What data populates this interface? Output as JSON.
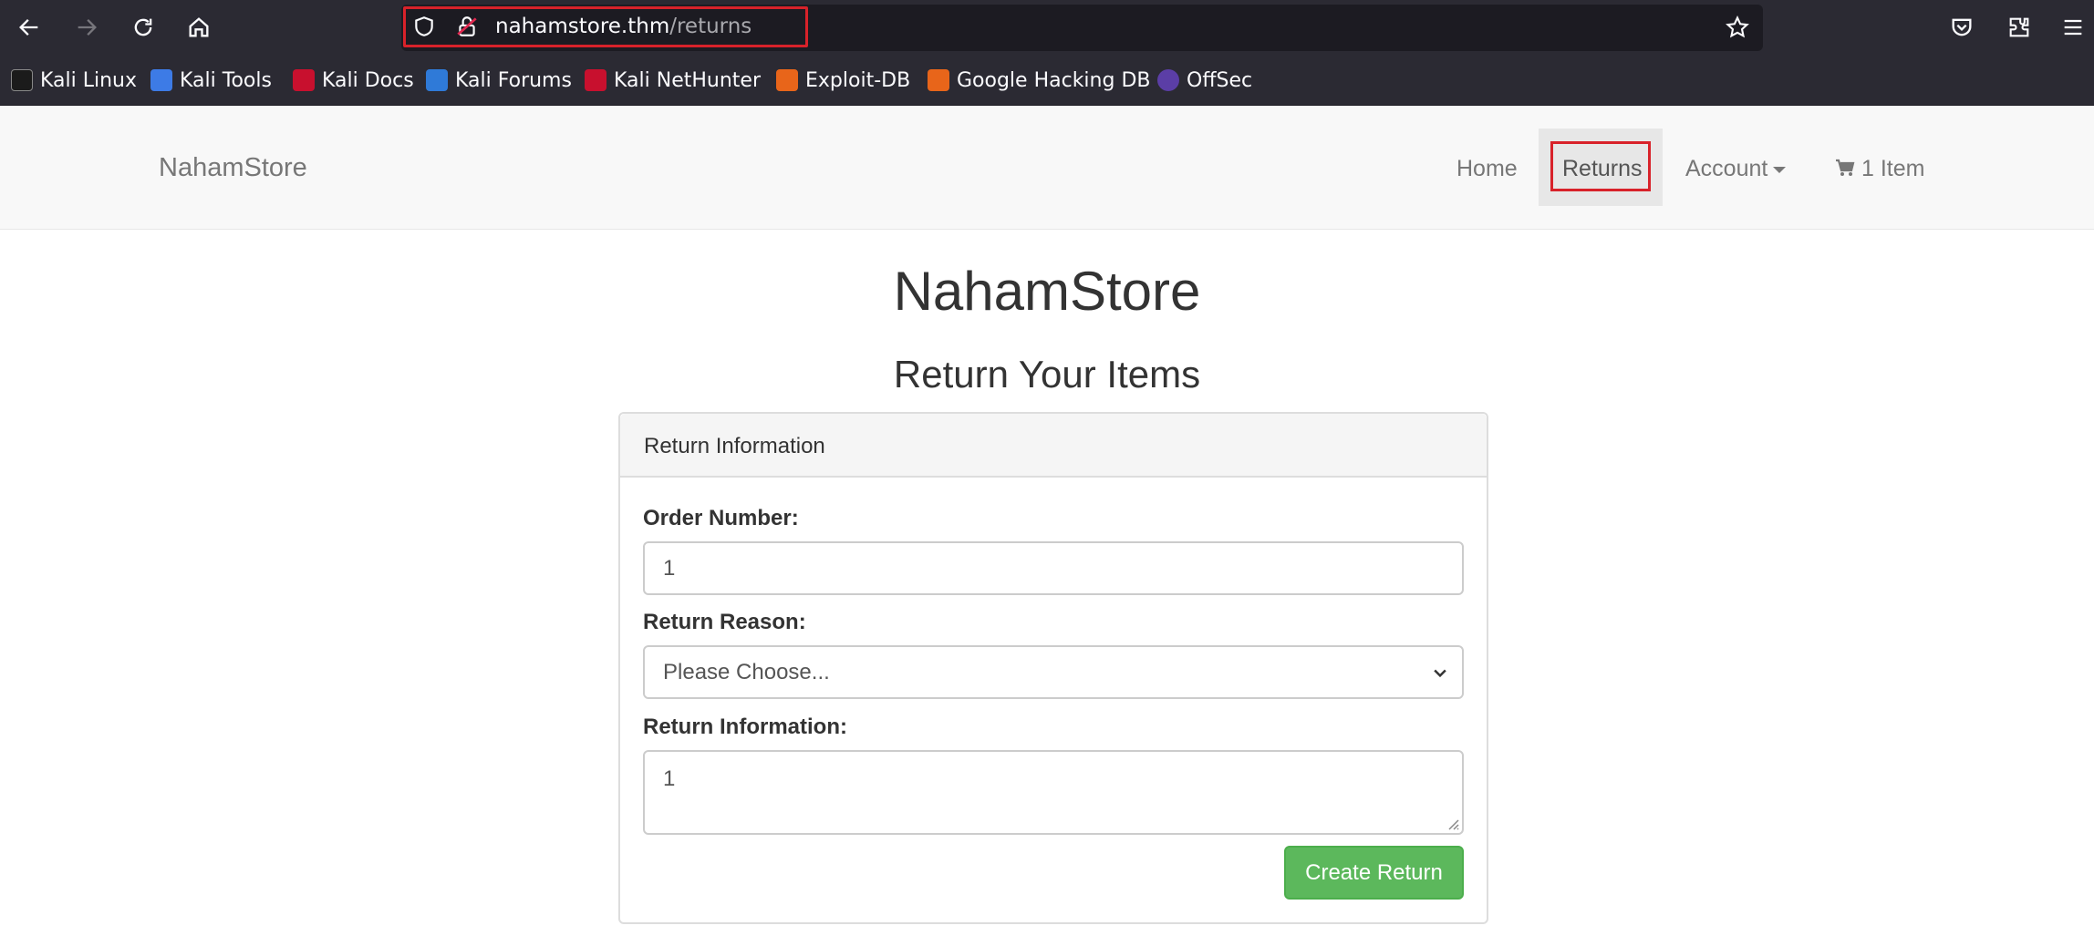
{
  "browser": {
    "url_host": "nahamstore.thm",
    "url_path": "/returns",
    "bookmarks": [
      {
        "label": "Kali Linux",
        "icon": "kali-dragon-icon",
        "color": "#1b1b1b"
      },
      {
        "label": "Kali Tools",
        "icon": "kali-tools-icon",
        "color": "#3d7be6"
      },
      {
        "label": "Kali Docs",
        "icon": "kali-docs-icon",
        "color": "#c8102e"
      },
      {
        "label": "Kali Forums",
        "icon": "kali-forums-icon",
        "color": "#2f7ad8"
      },
      {
        "label": "Kali NetHunter",
        "icon": "nethunter-icon",
        "color": "#c8102e"
      },
      {
        "label": "Exploit-DB",
        "icon": "exploit-db-icon",
        "color": "#e8651a"
      },
      {
        "label": "Google Hacking DB",
        "icon": "ghdb-icon",
        "color": "#e8651a"
      },
      {
        "label": "OffSec",
        "icon": "offsec-icon",
        "color": "#5b3ea6"
      }
    ]
  },
  "nav": {
    "brand": "NahamStore",
    "items": [
      {
        "label": "Home"
      },
      {
        "label": "Returns"
      },
      {
        "label": "Account"
      },
      {
        "label": "1 Item"
      }
    ]
  },
  "main": {
    "title": "NahamStore",
    "subtitle": "Return Your Items"
  },
  "panel": {
    "heading": "Return Information",
    "order_label": "Order Number:",
    "order_value": "1",
    "reason_label": "Return Reason:",
    "reason_value": "Please Choose...",
    "info_label": "Return Information:",
    "info_value": "1",
    "submit_label": "Create Return"
  },
  "colors": {
    "highlight": "#d8222a",
    "success": "#5cb85c"
  }
}
